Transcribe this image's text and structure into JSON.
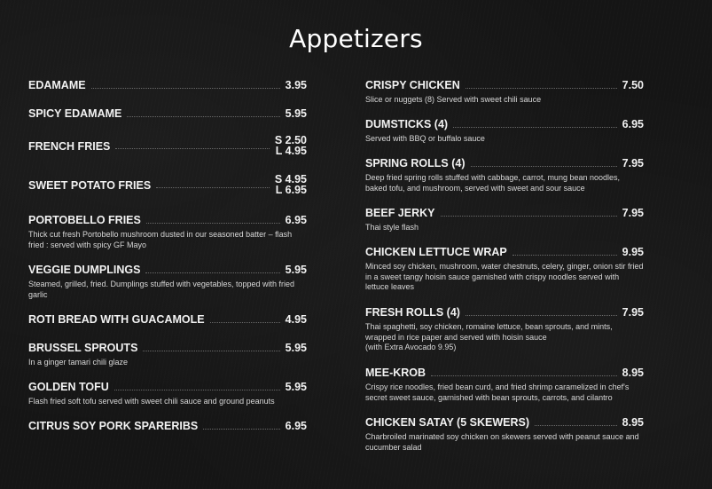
{
  "page": {
    "title": "Appetizers"
  },
  "left_column": [
    {
      "name": "EDAMAME",
      "price": "3.95",
      "description": ""
    },
    {
      "name": "SPICY EDAMAME",
      "price": "5.95",
      "description": ""
    },
    {
      "name": "FRENCH FRIES",
      "price_small": "S 2.50",
      "price_large": "L 4.95",
      "description": ""
    },
    {
      "name": "SWEET POTATO FRIES",
      "price_small": "S 4.95",
      "price_large": "L 6.95",
      "description": ""
    },
    {
      "name": "PORTOBELLO FRIES",
      "price": "6.95",
      "description": "Thick cut fresh Portobello mushroom dusted in our seasoned batter – flash fried : served with spicy GF Mayo"
    },
    {
      "name": "VEGGIE DUMPLINGS",
      "price": "5.95",
      "description": "Steamed, grilled, fried. Dumplings stuffed with vegetables, topped with fried garlic"
    },
    {
      "name": "ROTI BREAD WITH GUACAMOLE",
      "price": "4.95",
      "description": ""
    },
    {
      "name": "BRUSSEL SPROUTS",
      "price": "5.95",
      "description": "In a ginger tamari chili glaze"
    },
    {
      "name": "GOLDEN TOFU",
      "price": "5.95",
      "description": "Flash fried soft tofu served with sweet chili sauce and ground peanuts"
    },
    {
      "name": "CITRUS SOY PORK SPARERIBS",
      "price": "6.95",
      "description": ""
    }
  ],
  "right_column": [
    {
      "name": "CRISPY CHICKEN",
      "price": "7.50",
      "description": "Slice or nuggets (8) Served with sweet chili sauce"
    },
    {
      "name": "DUMSTICKS (4)",
      "price": "6.95",
      "description": "Served with BBQ or buffalo sauce"
    },
    {
      "name": "SPRING ROLLS (4)",
      "price": "7.95",
      "description": "Deep fried spring rolls stuffed with cabbage, carrot, mung bean noodles, baked tofu, and mushroom, served with sweet and sour sauce"
    },
    {
      "name": "BEEF JERKY",
      "price": "7.95",
      "description": "Thai style flash"
    },
    {
      "name": "CHICKEN LETTUCE WRAP",
      "price": "9.95",
      "description": "Minced soy chicken, mushroom, water chestnuts, celery, ginger, onion stir fried in a sweet tangy hoisin sauce garnished with crispy noodles served with lettuce leaves"
    },
    {
      "name": "FRESH ROLLS (4)",
      "price": "7.95",
      "description": "Thai spaghetti, soy chicken, romaine lettuce, bean sprouts, and mints, wrapped in rice paper and served with hoisin sauce",
      "description_extra": "(with Extra Avocado 9.95)"
    },
    {
      "name": "MEE-KROB",
      "price": "8.95",
      "description": "Crispy rice noodles, fried bean curd, and fried shrimp caramelized in chef's secret sweet sauce, garnished with bean sprouts, carrots, and cilantro"
    },
    {
      "name": "CHICKEN SATAY (5 SKEWERS)",
      "price": "8.95",
      "description": "Charbroiled marinated soy chicken on skewers served with peanut sauce and cucumber salad"
    }
  ]
}
